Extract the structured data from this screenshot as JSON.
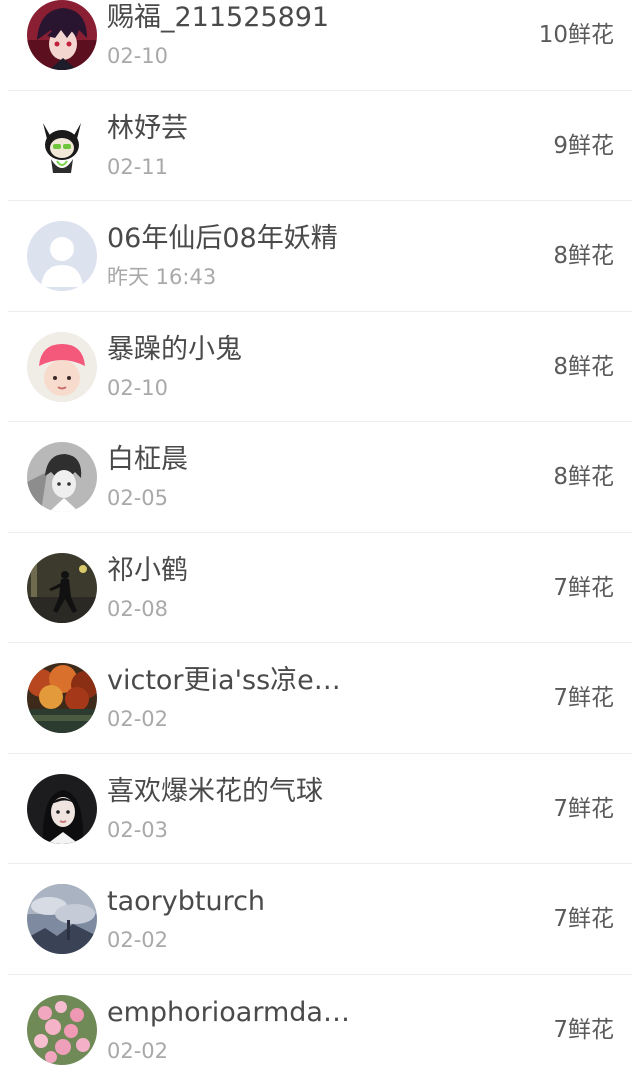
{
  "rows": [
    {
      "name": "赐福_211525891",
      "date": "02-10",
      "flowers": "10鲜花",
      "avatar": "anime-boy-red"
    },
    {
      "name": "林妤芸",
      "date": "02-11",
      "flowers": "9鲜花",
      "avatar": "chibi-demon"
    },
    {
      "name": "06年仙后08年妖精",
      "date": "昨天 16:43",
      "flowers": "8鲜花",
      "avatar": "default-person"
    },
    {
      "name": "暴躁的小鬼",
      "date": "02-10",
      "flowers": "8鲜花",
      "avatar": "baby-pink-hat"
    },
    {
      "name": "白柾晨",
      "date": "02-05",
      "flowers": "8鲜花",
      "avatar": "anime-boy-sketch"
    },
    {
      "name": "祁小鹤",
      "date": "02-08",
      "flowers": "7鲜花",
      "avatar": "dancer-night"
    },
    {
      "name": "victor更ia'ss凉e…",
      "date": "02-02",
      "flowers": "7鲜花",
      "avatar": "autumn-trees"
    },
    {
      "name": "喜欢爆米花的气球",
      "date": "02-03",
      "flowers": "7鲜花",
      "avatar": "girl-portrait"
    },
    {
      "name": "taorybturch",
      "date": "02-02",
      "flowers": "7鲜花",
      "avatar": "cloudy-sky"
    },
    {
      "name": "emphorioarmda…",
      "date": "02-02",
      "flowers": "7鲜花",
      "avatar": "pink-flowers"
    }
  ]
}
